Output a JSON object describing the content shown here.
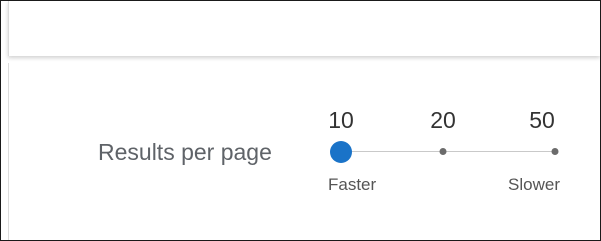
{
  "results_per_page": {
    "label": "Results per page",
    "options": [
      "10",
      "20",
      "50"
    ],
    "selected_value": "10",
    "selected_index": 0,
    "min_hint": "Faster",
    "max_hint": "Slower",
    "accent_color": "#1a73c8"
  }
}
